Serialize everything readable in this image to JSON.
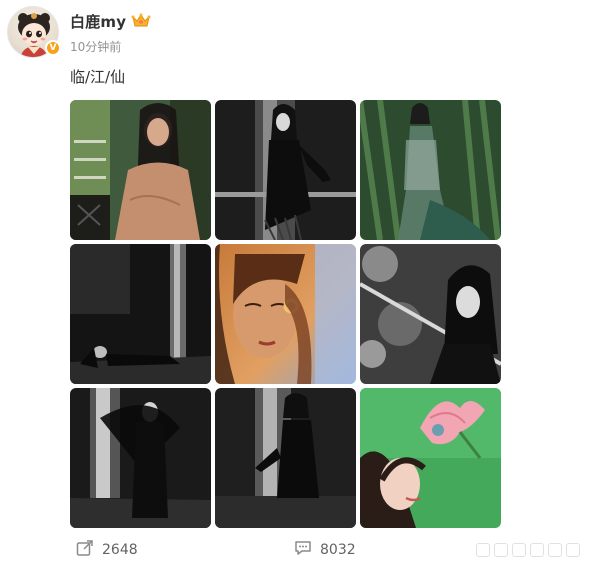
{
  "post": {
    "author": {
      "name": "白鹿my",
      "badge": "crown-badge-icon",
      "verified_icon": "verified-v-icon"
    },
    "timestamp": "10分钟前",
    "text": "临/江/仙",
    "images": [
      {
        "row": 1,
        "col": 1,
        "subject": "woman in beige robe by green window"
      },
      {
        "row": 1,
        "col": 2,
        "subject": "woman in black dress on railing"
      },
      {
        "row": 1,
        "col": 3,
        "subject": "woman in sheer green gown in forest"
      },
      {
        "row": 2,
        "col": 1,
        "subject": "woman lying by dark waterfall"
      },
      {
        "row": 2,
        "col": 2,
        "subject": "close-up face in warm light"
      },
      {
        "row": 2,
        "col": 3,
        "subject": "black and white portrait with sword"
      },
      {
        "row": 3,
        "col": 1,
        "subject": "figure with black veil by waterfall"
      },
      {
        "row": 3,
        "col": 2,
        "subject": "woman in black on rock by waterfall"
      },
      {
        "row": 3,
        "col": 3,
        "subject": "woman gazing up at pink flower"
      }
    ],
    "footer": {
      "repost_icon": "share-arrow-icon",
      "repost_count": "2648",
      "comment_icon": "comment-bubble-icon",
      "comment_count": "8032"
    },
    "colors": {
      "verified": "#f7a21b",
      "text_primary": "#333333",
      "text_muted": "#939393"
    }
  }
}
